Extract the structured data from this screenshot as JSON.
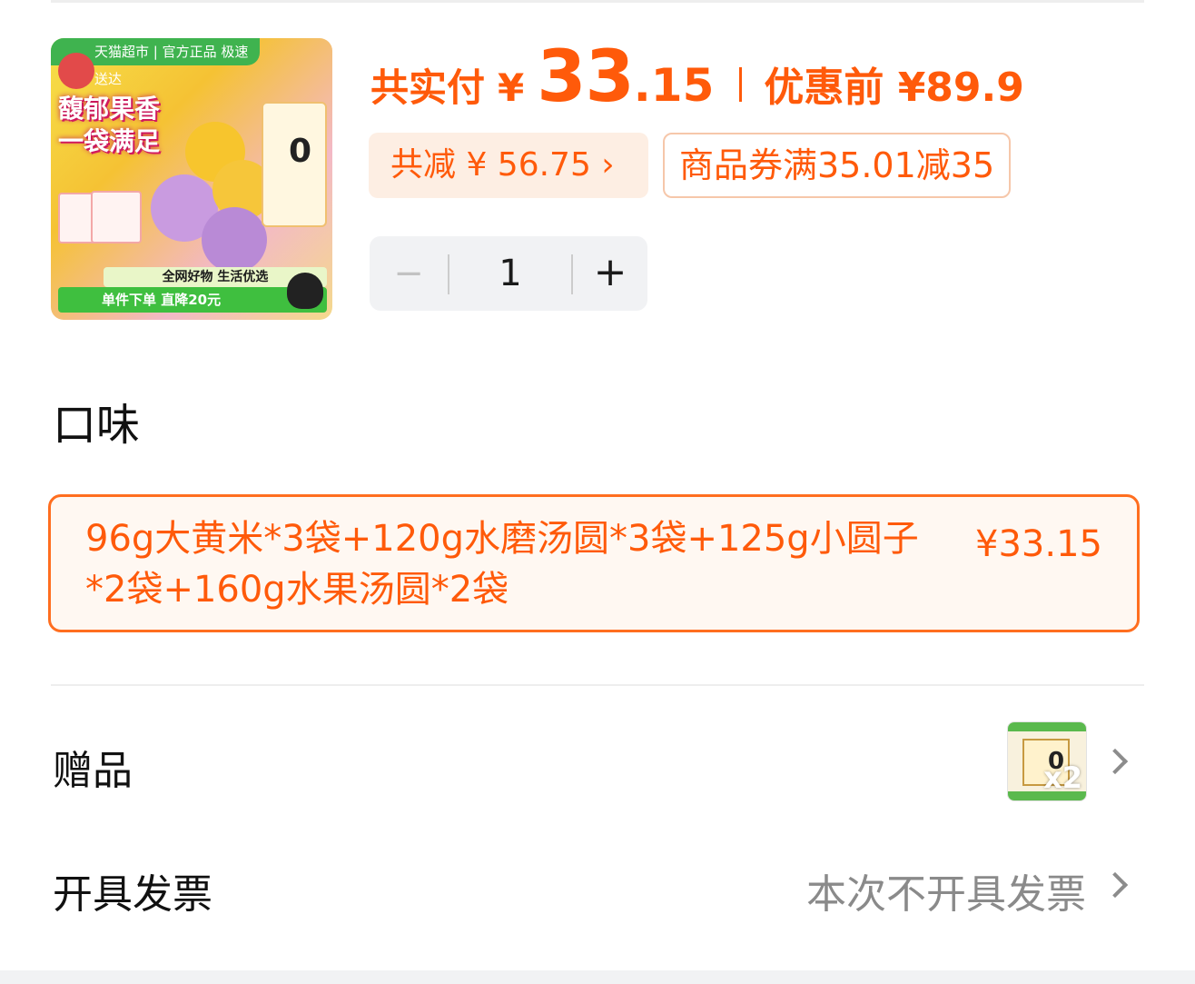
{
  "product": {
    "thumbnail": {
      "band_text": "天猫超市 | 官方正品 极速送达",
      "slogan_line1": "馥郁果香",
      "slogan_line2": "一袋满足",
      "tag1": "全网好物 生活优选",
      "tag2": "单件下单 直降20元"
    }
  },
  "price": {
    "label": "共实付",
    "currency": "¥",
    "integer": "33",
    "decimal": ".15",
    "original_label": "优惠前 ¥89.9",
    "accent_color": "#ff5a0a"
  },
  "discount": {
    "save_text": "共减 ¥ 56.75 ›",
    "coupon_text": "商品券满35.01减35"
  },
  "quantity": {
    "minus": "−",
    "value": "1",
    "plus": "+"
  },
  "flavor": {
    "title": "口味",
    "option_text": "96g大黄米*3袋+120g水磨汤圆*3袋+125g小圆子*2袋+160g水果汤圆*2袋",
    "option_price": "¥33.15",
    "selected": true
  },
  "gift": {
    "label": "赠品",
    "quantity": "x2"
  },
  "invoice": {
    "label": "开具发票",
    "value": "本次不开具发票"
  }
}
